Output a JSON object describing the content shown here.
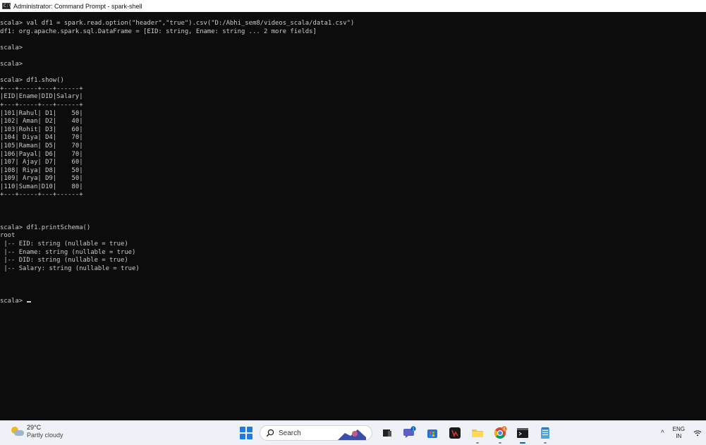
{
  "window": {
    "icon_label": "C:\\",
    "title": "Administrator: Command Prompt - spark-shell"
  },
  "console": {
    "lines": [
      "scala> val df1 = spark.read.option(\"header\",\"true\").csv(\"D:/Abhi_sem8/videos_scala/data1.csv\")",
      "df1: org.apache.spark.sql.DataFrame = [EID: string, Ename: string ... 2 more fields]",
      "",
      "scala>",
      "",
      "scala>",
      "",
      "scala> df1.show()",
      "+---+-----+---+------+",
      "|EID|Ename|DID|Salary|",
      "+---+-----+---+------+",
      "|101|Rahul| D1|    50|",
      "|102| Aman| D2|    40|",
      "|103|Rohit| D3|    60|",
      "|104| Diya| D4|    70|",
      "|105|Raman| D5|    70|",
      "|106|Payal| D6|    70|",
      "|107| Ajay| D7|    60|",
      "|108| Riya| D8|    50|",
      "|109| Arya| D9|    50|",
      "|110|Suman|D10|    80|",
      "+---+-----+---+------+",
      "",
      "",
      "",
      "scala> df1.printSchema()",
      "root",
      " |-- EID: string (nullable = true)",
      " |-- Ename: string (nullable = true)",
      " |-- DID: string (nullable = true)",
      " |-- Salary: string (nullable = true)",
      "",
      "",
      "",
      "scala> "
    ]
  },
  "taskbar": {
    "weather": {
      "temperature": "29°C",
      "condition": "Partly cloudy"
    },
    "search_label": "Search",
    "notification_count": "1",
    "chrome_badge": "6",
    "language": {
      "line1": "ENG",
      "line2": "IN"
    },
    "tray_chevron": "^",
    "accent_color": "#0067c0"
  }
}
